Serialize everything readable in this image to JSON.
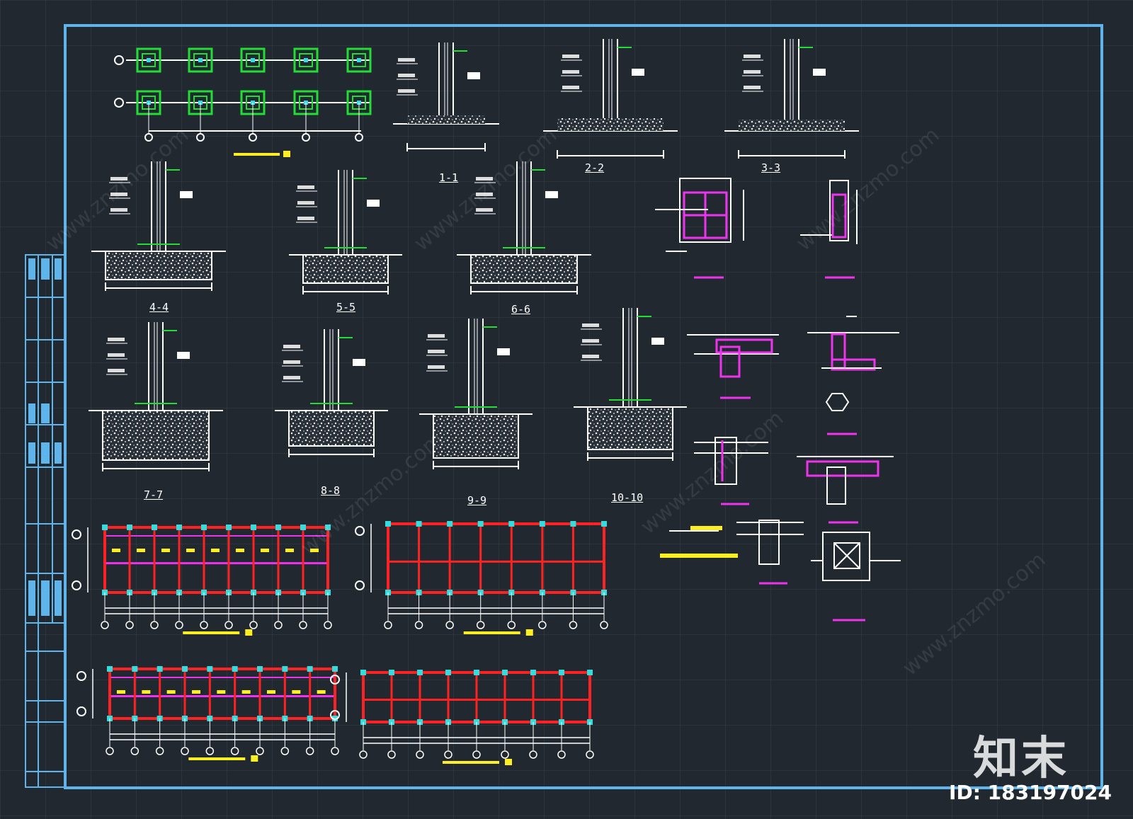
{
  "drawing": {
    "background": "#212830",
    "frame_color": "#5fb4ea",
    "section_labels": [
      "1-1",
      "2-2",
      "3-3",
      "4-4",
      "5-5",
      "6-6",
      "7-7",
      "8-8",
      "9-9",
      "10-10"
    ],
    "colors": {
      "line": "#ffffff",
      "green": "#22dd33",
      "red": "#ff2222",
      "magenta": "#ee33ee",
      "yellow": "#ffee22",
      "cyan": "#33dddd"
    }
  },
  "watermark": {
    "brand": "知末",
    "id_text": "ID: 183197024",
    "site": "www.znzmo.com"
  }
}
